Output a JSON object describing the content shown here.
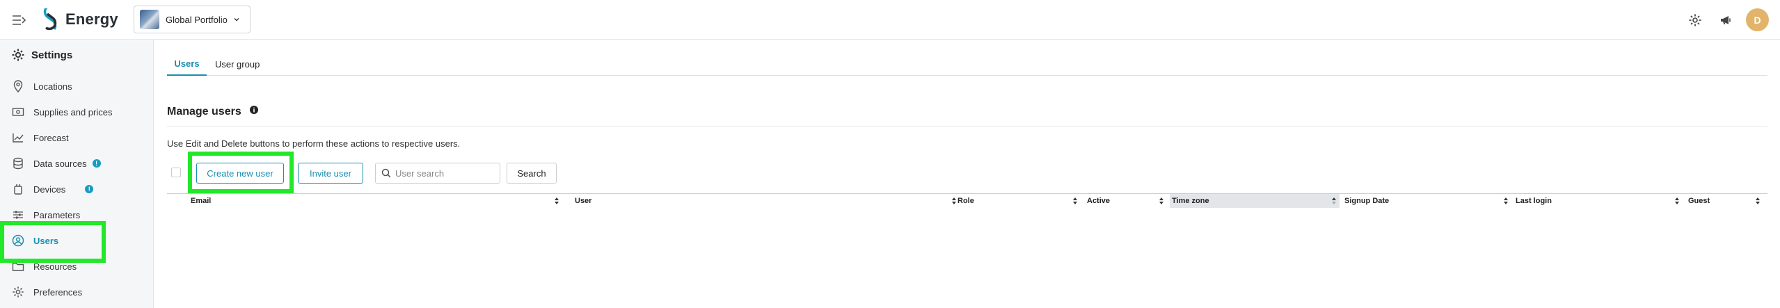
{
  "app": {
    "name": "Energy"
  },
  "portfolio": {
    "name": "Global Portfolio"
  },
  "user": {
    "initial": "D"
  },
  "sidebar": {
    "heading": "Settings",
    "items": [
      {
        "label": "Locations",
        "icon": "location-pin-icon"
      },
      {
        "label": "Supplies and prices",
        "icon": "money-icon"
      },
      {
        "label": "Forecast",
        "icon": "chart-line-icon"
      },
      {
        "label": "Data sources",
        "icon": "database-icon",
        "badge": "!"
      },
      {
        "label": "Devices",
        "icon": "device-icon",
        "badge": "!"
      },
      {
        "label": "Parameters",
        "icon": "sliders-icon"
      },
      {
        "label": "Users",
        "icon": "user-circle-icon",
        "active": true
      },
      {
        "label": "Resources",
        "icon": "folder-icon"
      },
      {
        "label": "Preferences",
        "icon": "gear-icon"
      }
    ]
  },
  "tabs": [
    {
      "label": "Users",
      "active": true
    },
    {
      "label": "User group",
      "active": false
    }
  ],
  "manage": {
    "title": "Manage users",
    "hint": "Use Edit and Delete buttons to perform these actions to respective users.",
    "create_label": "Create new user",
    "invite_label": "Invite user",
    "search_placeholder": "User search",
    "search_label": "Search"
  },
  "table": {
    "columns": [
      "Email",
      "User",
      "Role",
      "Active",
      "Time zone",
      "Signup Date",
      "Last login",
      "Guest"
    ],
    "sorted_column": "Time zone",
    "rows": []
  },
  "colors": {
    "accent": "#1a8fb0",
    "highlight": "#22e82a",
    "avatar": "#e2b46a"
  }
}
